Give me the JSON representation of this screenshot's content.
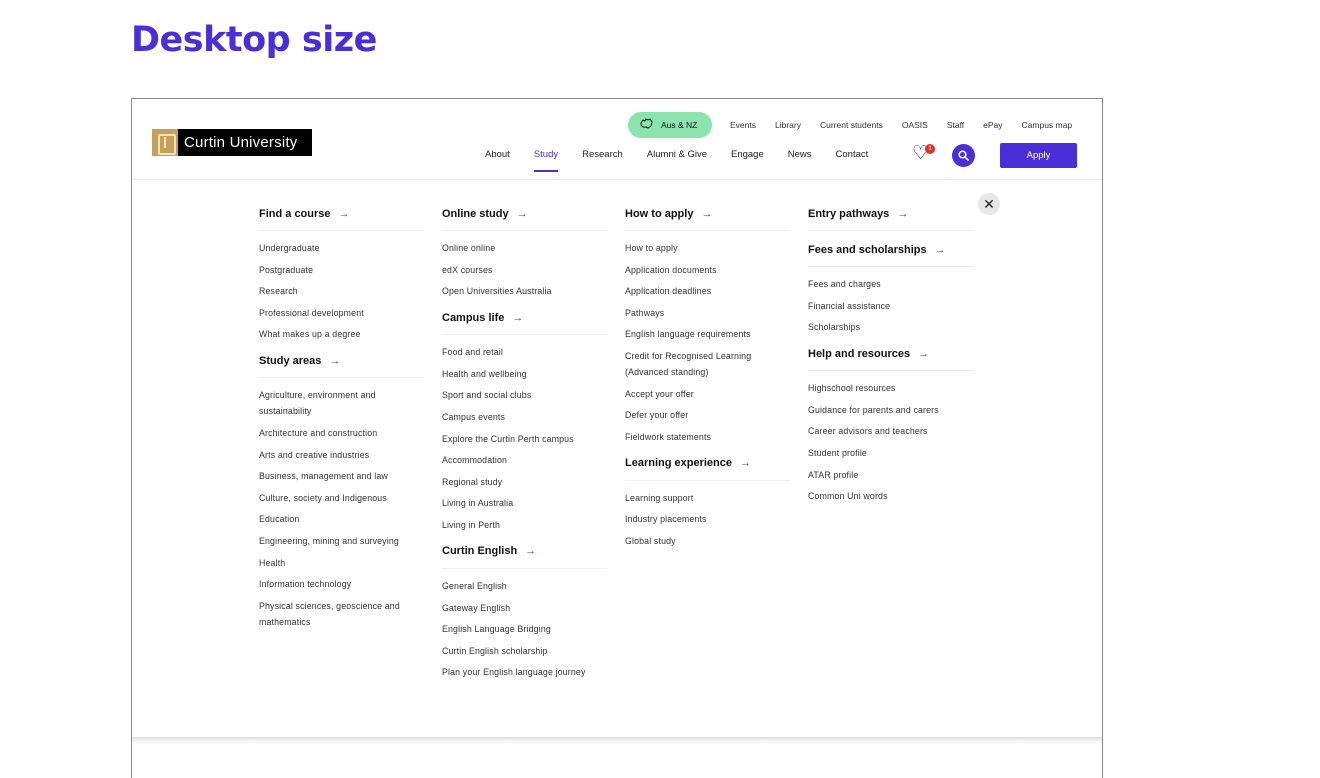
{
  "page_heading": "Desktop size",
  "logo_text": "Curtin University",
  "utility": {
    "region": "Aus & NZ",
    "links": [
      "Events",
      "Library",
      "Current students",
      "OASIS",
      "Staff",
      "ePay",
      "Campus map"
    ]
  },
  "nav": {
    "items": [
      "About",
      "Study",
      "Research",
      "Alumni & Give",
      "Engage",
      "News",
      "Contact"
    ],
    "active": "Study",
    "shortlist_count": "1",
    "apply_label": "Apply"
  },
  "icons": {
    "region": "australia-map-icon",
    "shortlist": "heart-icon",
    "search": "search-icon",
    "close": "close-icon",
    "section_arrow": "arrow-right-icon"
  },
  "colors": {
    "accent": "#4b2fd6",
    "region_pill": "#8be3ae",
    "badge": "#d9342b"
  },
  "menu": {
    "col1": [
      {
        "title": "Find a course",
        "links": [
          "Undergraduate",
          "Postgraduate",
          "Research",
          "Professional development",
          "What makes up a degree"
        ]
      },
      {
        "title": "Study areas",
        "links": [
          "Agriculture, environment and sustainability",
          "Architecture and construction",
          "Arts and creative industries",
          "Business, management and law",
          "Culture, society and Indigenous",
          "Education",
          "Engineering, mining and surveying",
          "Health",
          "Information technology",
          "Physical sciences, geoscience and mathematics"
        ]
      }
    ],
    "col2": [
      {
        "title": "Online study",
        "links": [
          "Online online",
          "edX courses",
          "Open Universities Australia"
        ]
      },
      {
        "title": "Campus life",
        "links": [
          "Food and retail",
          "Health and wellbeing",
          "Sport and social clubs",
          "Campus events",
          "Explore the Curtin Perth campus",
          "Accommodation",
          "Regional study",
          "Living in Australia",
          "Living in Perth"
        ]
      },
      {
        "title": "Curtin English",
        "links": [
          "General English",
          "Gateway English",
          "English Language Bridging",
          "Curtin English scholarship",
          "Plan your English language journey"
        ]
      }
    ],
    "col3": [
      {
        "title": "How to apply",
        "links": [
          "How to apply",
          "Application documents",
          "Application deadlines",
          "Pathways",
          "English language requirements",
          "Credit for Recognised Learning (Advanced standing)",
          "Accept your offer",
          "Defer your offer",
          "Fieldwork statements"
        ]
      },
      {
        "title": "Learning experience",
        "links": [
          "Learning support",
          "Industry placements",
          "Global study"
        ]
      }
    ],
    "col4": [
      {
        "title": "Entry pathways",
        "links": []
      },
      {
        "title": "Fees and scholarships",
        "links": [
          "Fees and charges",
          "Financial assistance",
          "Scholarships"
        ]
      },
      {
        "title": "Help and resources",
        "links": [
          "Highschool resources",
          "Guidance for parents and carers",
          "Career advisors and teachers",
          "Student profile",
          "ATAR profile",
          "Common Uni words"
        ]
      }
    ]
  }
}
